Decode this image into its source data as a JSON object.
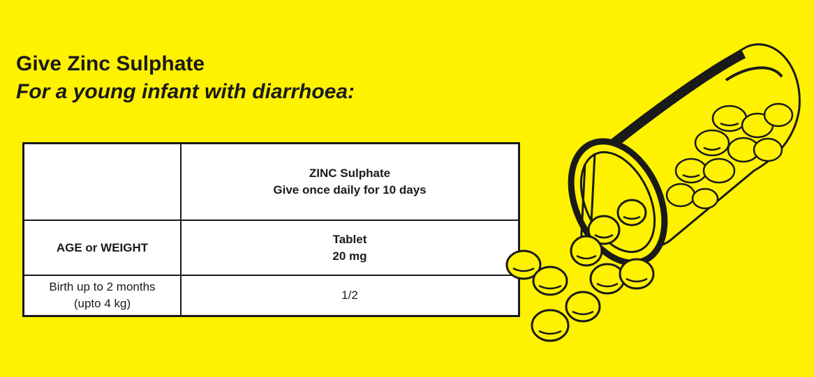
{
  "header": {
    "title": "Give Zinc Sulphate",
    "subtitle": "For a young infant with diarrhoea:"
  },
  "table": {
    "top_left": "",
    "drug_name": "ZINC Sulphate",
    "drug_instruction": "Give once daily for 10 days",
    "row_header": "AGE or WEIGHT",
    "form_name": "Tablet",
    "form_strength": "20 mg",
    "age_group_line1": "Birth up to 2 months",
    "age_group_line2": "(upto 4 kg)",
    "dose": "1/2"
  },
  "illustration": {
    "icon": "spilled-pill-bottle-icon"
  },
  "colors": {
    "background": "#fff200",
    "ink": "#1a1a1a",
    "table_fill": "#ffffff"
  }
}
